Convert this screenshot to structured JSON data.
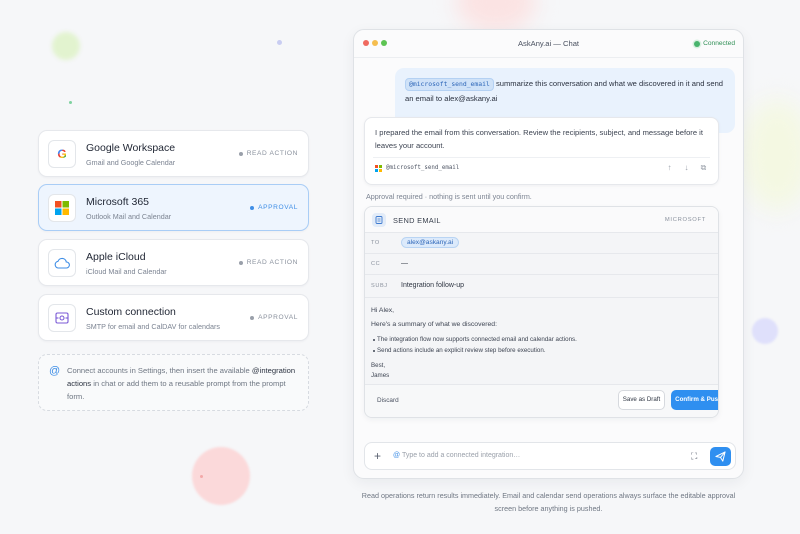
{
  "connectors": [
    {
      "name": "Google Workspace",
      "desc": "Gmail and Google Calendar",
      "badge": "READ ACTION",
      "icon": "google-logo"
    },
    {
      "name": "Microsoft 365",
      "desc": "Outlook Mail and Calendar",
      "badge": "APPROVAL",
      "icon": "microsoft-logo"
    },
    {
      "name": "Apple iCloud",
      "desc": "iCloud Mail and Calendar",
      "badge": "READ ACTION",
      "icon": "cloud-icon"
    },
    {
      "name": "Custom connection",
      "desc": "SMTP for email and CalDAV for calendars",
      "badge": "APPROVAL",
      "icon": "server-icon"
    }
  ],
  "hint": {
    "icon": "@",
    "text_before": "Connect accounts in Settings, then insert the available",
    "strong": "@integration actions",
    "text_after": "in chat or add them to a reusable prompt from the prompt form."
  },
  "window": {
    "title": "AskAny.ai — Chat",
    "status": "Connected",
    "accent": "#2f8ff0"
  },
  "user_message": {
    "mention": "@microsoft_send_email",
    "text": "summarize this conversation and what we discovered in it and send an email to alex@askany.ai"
  },
  "assistant_message": {
    "text": "I prepared the email from this conversation. Review the recipients, subject, and message before it leaves your account.",
    "tool": "@microsoft_send_email",
    "actions": [
      "↑",
      "↓",
      "⧉"
    ]
  },
  "approval_note": "Approval required · nothing is sent until you confirm.",
  "send_card": {
    "title": "SEND EMAIL",
    "provider": "MICROSOFT",
    "to_label": "TO",
    "to_value": "alex@askany.ai",
    "cc_label": "CC",
    "cc_value": "—",
    "subj_label": "SUBJ",
    "subj_value": "Integration follow-up",
    "greeting": "Hi Alex,",
    "intro": "Here's a summary of what we discovered:",
    "bullets": [
      "The integration flow now supports connected email and calendar actions.",
      "Send actions include an explicit review step before execution."
    ],
    "signoff": "Best,",
    "signature": "James",
    "discard_label": "Discard",
    "draft_label": "Save as Draft",
    "push_label": "Confirm & Push"
  },
  "composer": {
    "at": "@",
    "placeholder": "Type to add a connected integration…"
  },
  "footnote": "Read operations return results immediately. Email and calendar send operations always surface the editable approval screen before anything is pushed."
}
